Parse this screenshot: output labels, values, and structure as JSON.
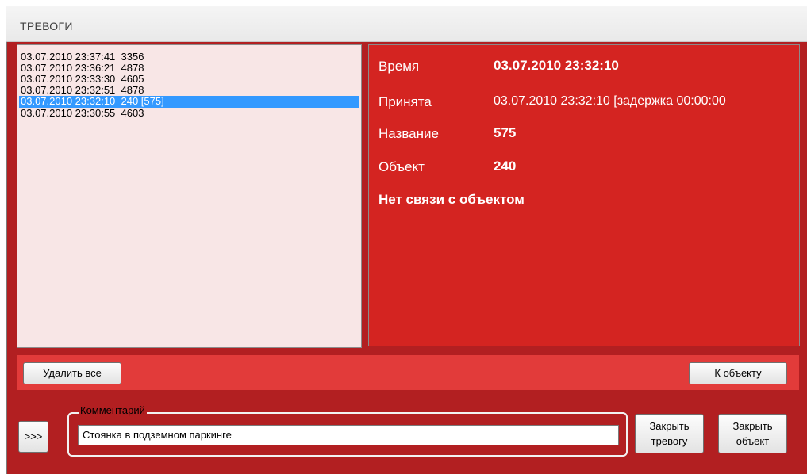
{
  "window": {
    "title": "ТРЕВОГИ"
  },
  "alarm_list": [
    {
      "text": "03.07.2010 23:37:41  3356",
      "selected": false
    },
    {
      "text": "03.07.2010 23:36:21  4878",
      "selected": false
    },
    {
      "text": "03.07.2010 23:33:30  4605",
      "selected": false
    },
    {
      "text": "03.07.2010 23:32:51  4878",
      "selected": false
    },
    {
      "text": "03.07.2010 23:32:10  240 [575]",
      "selected": true
    },
    {
      "text": "03.07.2010 23:30:55  4603",
      "selected": false
    }
  ],
  "details": {
    "time_label": "Время",
    "time_value": "03.07.2010 23:32:10",
    "accepted_label": "Принята",
    "accepted_value": "03.07.2010 23:32:10 [задержка 00:00:00",
    "name_label": "Название",
    "name_value": "575",
    "object_label": "Объект",
    "object_value": "240",
    "alarm_message": "Нет связи с объектом"
  },
  "buttons": {
    "delete_all": "Удалить все",
    "to_object": "К объекту",
    "expand": ">>>",
    "close_alarm_line1": "Закрыть",
    "close_alarm_line2": "тревогу",
    "close_object_line1": "Закрыть",
    "close_object_line2": "объект"
  },
  "comment": {
    "legend": "Комментарий",
    "value": "Стоянка в подземном паркинге"
  },
  "colors": {
    "frame": "#b21f21",
    "details_bg": "#d42421",
    "button_bar": "#e23b3a",
    "list_bg": "#f8e6e6",
    "selection": "#3399ff"
  }
}
